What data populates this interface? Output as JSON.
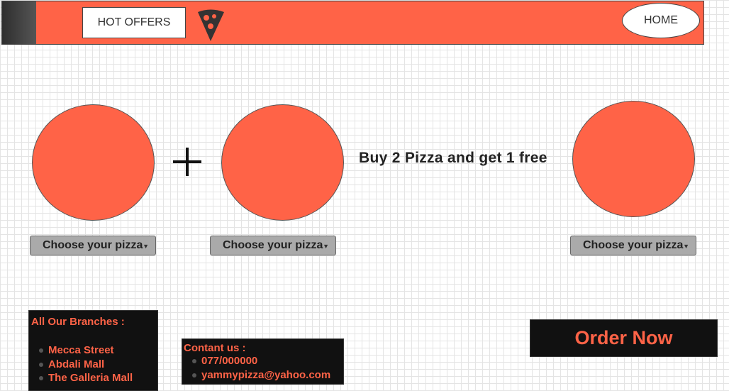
{
  "header": {
    "hot_offers_label": "HOT OFFERS",
    "home_label": "HOME",
    "logo_icon": "pizza-slice-icon",
    "brand_color": "#ff6347"
  },
  "offer": {
    "promo_text": "Buy 2 Pizza and get 1 free",
    "plus_icon": "plus-icon",
    "selects": [
      {
        "selected": "Choose your pizza"
      },
      {
        "selected": "Choose your pizza"
      },
      {
        "selected": "Choose your pizza"
      }
    ]
  },
  "branches": {
    "title": "All Our Branches :",
    "items": [
      "Mecca Street",
      "Abdali Mall",
      "The Galleria Mall"
    ]
  },
  "contact": {
    "title": "Contant us :",
    "items": [
      "077/000000",
      "yammypizza@yahoo.com"
    ]
  },
  "order_button": {
    "label": "Order Now"
  }
}
